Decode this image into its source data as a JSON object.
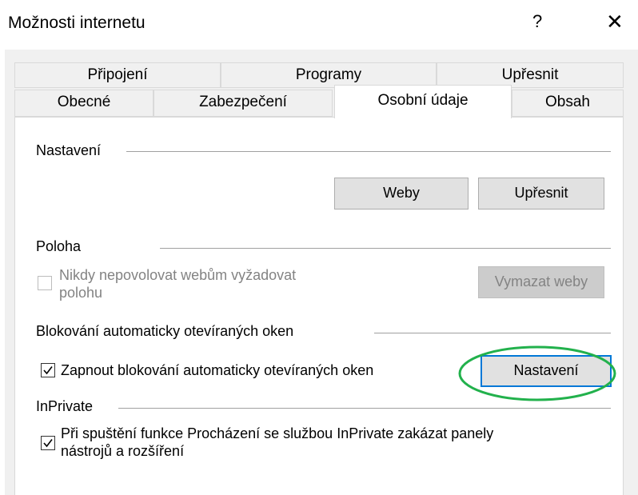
{
  "window": {
    "title": "Možnosti internetu",
    "help_glyph": "?",
    "close_glyph": "✕"
  },
  "tabs": {
    "row_back": [
      {
        "label": "Připojení"
      },
      {
        "label": "Programy"
      },
      {
        "label": "Upřesnit"
      }
    ],
    "row_front": [
      {
        "label": "Obecné"
      },
      {
        "label": "Zabezpečení"
      },
      {
        "label": "Osobní údaje",
        "active": true
      },
      {
        "label": "Obsah"
      }
    ]
  },
  "settings": {
    "group_label": "Nastavení",
    "sites_button": "Weby",
    "advanced_button": "Upřesnit"
  },
  "location": {
    "group_label": "Poloha",
    "never_allow_checkbox_label_line1": "Nikdy nepovolovat webům vyžadovat",
    "never_allow_checkbox_label_line2": "polohu",
    "never_allow_checked": false,
    "never_allow_disabled": true,
    "clear_sites_button": "Vymazat weby",
    "clear_sites_disabled": true
  },
  "popup_blocker": {
    "group_label": "Blokování automaticky otevíraných oken",
    "enable_checkbox_label": "Zapnout blokování automaticky otevíraných oken",
    "enable_checked": true,
    "settings_button": "Nastavení",
    "annotation_color": "#22b14c"
  },
  "inprivate": {
    "group_label": "InPrivate",
    "disable_toolbars_label_line1": "Při spuštění funkce Procházení se službou InPrivate zakázat panely",
    "disable_toolbars_label_line2": "nástrojů a rozšíření",
    "disable_toolbars_checked": true
  }
}
